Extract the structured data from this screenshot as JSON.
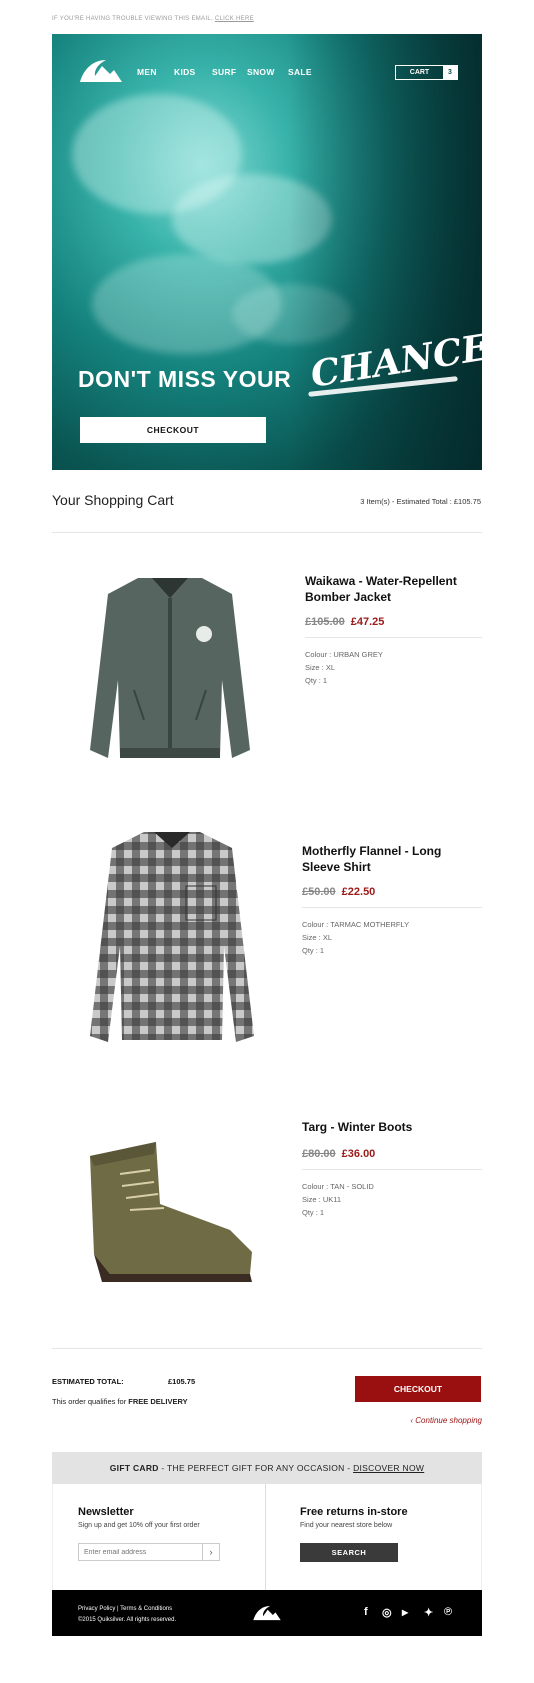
{
  "preheader": {
    "text": "IF YOU'RE HAVING TROUBLE VIEWING THIS EMAIL,",
    "link": "CLICK HERE"
  },
  "hero": {
    "nav": [
      "MEN",
      "KIDS",
      "SURF",
      "SNOW",
      "SALE"
    ],
    "cart_label": "CART",
    "cart_count": "3",
    "headline": "DON'T MISS YOUR",
    "script_word": "CHANCE",
    "button": "CHECKOUT"
  },
  "cart": {
    "title": "Your Shopping Cart",
    "summary": "3 Item(s) - Estimated Total : £105.75"
  },
  "products": [
    {
      "name": "Waikawa - Water-Repellent Bomber Jacket",
      "old_price": "£105.00",
      "new_price": "£47.25",
      "colour": "Colour : URBAN GREY",
      "size": "Size : XL",
      "qty": "Qty : 1"
    },
    {
      "name": "Motherfly Flannel - Long Sleeve Shirt",
      "old_price": "£50.00",
      "new_price": "£22.50",
      "colour": "Colour : TARMAC MOTHERFLY",
      "size": "Size : XL",
      "qty": "Qty : 1"
    },
    {
      "name": "Targ - Winter Boots",
      "old_price": "£80.00",
      "new_price": "£36.00",
      "colour": "Colour : TAN - SOLID",
      "size": "Size : UK11",
      "qty": "Qty : 1"
    }
  ],
  "totals": {
    "label": "ESTIMATED TOTAL:",
    "value": "£105.75",
    "delivery_prefix": "This order qualifies for",
    "delivery_bold": "FREE DELIVERY",
    "checkout": "CHECKOUT",
    "continue": "Continue shopping"
  },
  "gift": {
    "bold": "GIFT CARD",
    "text": " - THE PERFECT GIFT FOR ANY OCCASION - ",
    "link": "DISCOVER NOW"
  },
  "newsletter": {
    "title": "Newsletter",
    "subtitle": "Sign up and get 10% off your first order",
    "placeholder": "Enter email address"
  },
  "returns": {
    "title": "Free returns in-store",
    "subtitle": "Find your nearest store below",
    "button": "SEARCH"
  },
  "footer": {
    "privacy": "Privacy Policy",
    "terms": "Terms & Conditions",
    "copyright": "©2015 Quiksilver. All rights reserved."
  },
  "social_icons": [
    "facebook-icon",
    "instagram-icon",
    "youtube-icon",
    "twitter-icon",
    "pinterest-icon"
  ],
  "colors": {
    "accent": "#9a0f0f",
    "hero_teal": "#15827d",
    "footer_bg": "#000000"
  }
}
